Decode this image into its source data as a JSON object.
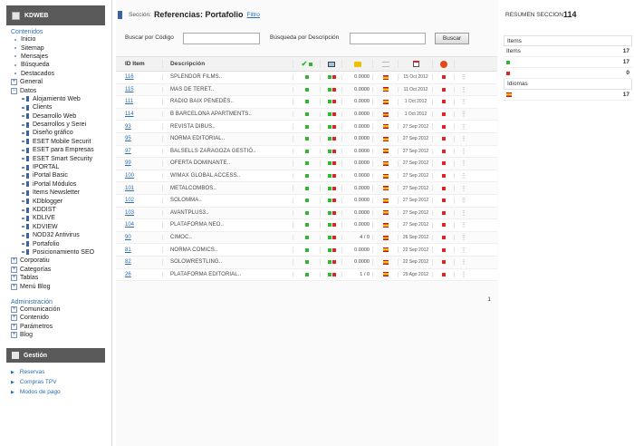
{
  "sidebar": {
    "brand": "KDWEB",
    "contenidos_title": "Contenidos",
    "contenidos_items": [
      "Inicio",
      "Sitemap",
      "Mensajes",
      "Búsqueda",
      "Destacados"
    ],
    "general_label": "General",
    "datos_label": "Datos",
    "datos_items": [
      "Alojamiento Web",
      "Clients",
      "Desarrollo Web",
      "Desarrollos y Serei",
      "Diseño gráfico",
      "ESET Mobile Securit",
      "ESET para Empresas",
      "ESET Smart Security",
      "IPORTAL",
      "iPortal Basic",
      "iPortal Módulos",
      "Items Newsletter",
      "KDblogger",
      "KDDIST",
      "KDLIVE",
      "KDVIEW",
      "NOD32 Antivirus",
      "Portafolio",
      "Posicionamiento SEO"
    ],
    "more_groups": [
      "Corporatiu",
      "Categorías",
      "Tablas",
      "Menú Blog"
    ],
    "admin_title": "Administración",
    "admin_items": [
      "Comunicación",
      "Contenido",
      "Parámetros",
      "Blog"
    ],
    "gestion_title": "Gestión",
    "gestion_items": [
      "Reservas",
      "Compras TPV",
      "Modos de pago"
    ]
  },
  "header": {
    "seccion_label": "Sección:",
    "title": "Referencias: Portafolio",
    "filtro": "Filtro"
  },
  "search": {
    "by_code_label": "Buscar por Código",
    "by_desc_label": "Búsqueda por Descripción",
    "button": "Buscar"
  },
  "grid": {
    "col_id": "ID Item",
    "col_desc": "Descripción",
    "rows": [
      {
        "id": "116",
        "desc": "SPLENDOR FILMS..",
        "count": "0.0000",
        "date": "15 Oct 2012"
      },
      {
        "id": "115",
        "desc": "MAS DE TERET..",
        "count": "0.0000",
        "date": "11 Oct 2012"
      },
      {
        "id": "111",
        "desc": "RADIO BAIX PENEDÈS..",
        "count": "0.0000",
        "date": "1 Oct 2012"
      },
      {
        "id": "114",
        "desc": "B BARCELONA APARTMENTS..",
        "count": "0.0000",
        "date": "1 Oct 2012"
      },
      {
        "id": "93",
        "desc": "REVISTA DIBUS..",
        "count": "0.0000",
        "date": "27 Sep 2012"
      },
      {
        "id": "95",
        "desc": "NORMA EDITORIAL..",
        "count": "0.0000",
        "date": "27 Sep 2012"
      },
      {
        "id": "97",
        "desc": "BALSELLS ZARAGOZA GESTIÓ..",
        "count": "0.0000",
        "date": "27 Sep 2012"
      },
      {
        "id": "99",
        "desc": "OFERTA DOMINANTE..",
        "count": "0.0000",
        "date": "27 Sep 2012"
      },
      {
        "id": "100",
        "desc": "WIMAX GLOBAL ACCESS..",
        "count": "0.0000",
        "date": "27 Sep 2012"
      },
      {
        "id": "101",
        "desc": "METALCOMBOS..",
        "count": "0.0000",
        "date": "27 Sep 2012"
      },
      {
        "id": "102",
        "desc": "SOLOMMA..",
        "count": "0.0000",
        "date": "27 Sep 2012"
      },
      {
        "id": "103",
        "desc": "AVANTPLUS3..",
        "count": "0.0000",
        "date": "27 Sep 2012"
      },
      {
        "id": "104",
        "desc": "PLATAFORMA NEO..",
        "count": "0.0000",
        "date": "27 Sep 2012"
      },
      {
        "id": "90",
        "desc": "CIMOC..",
        "count": "4 / 0",
        "date": "26 Sep 2012"
      },
      {
        "id": "81",
        "desc": "NORMA COMICS..",
        "count": "0.0000",
        "date": "22 Sep 2012"
      },
      {
        "id": "82",
        "desc": "SOLOWRESTLING..",
        "count": "0.0000",
        "date": "22 Sep 2012"
      },
      {
        "id": "26",
        "desc": "PLATAFORMA EDITORIAL..",
        "count": "1 / 0",
        "date": "29 Ago 2012"
      }
    ]
  },
  "pager": "1",
  "summary": {
    "title": "RESUMEN SECCION",
    "count": "114",
    "items_header": "Items",
    "items_total_label": "Items",
    "items_total": "17",
    "active": "17",
    "inactive": "0",
    "idiomas_header": "Idiomas",
    "lang_es": "17"
  }
}
